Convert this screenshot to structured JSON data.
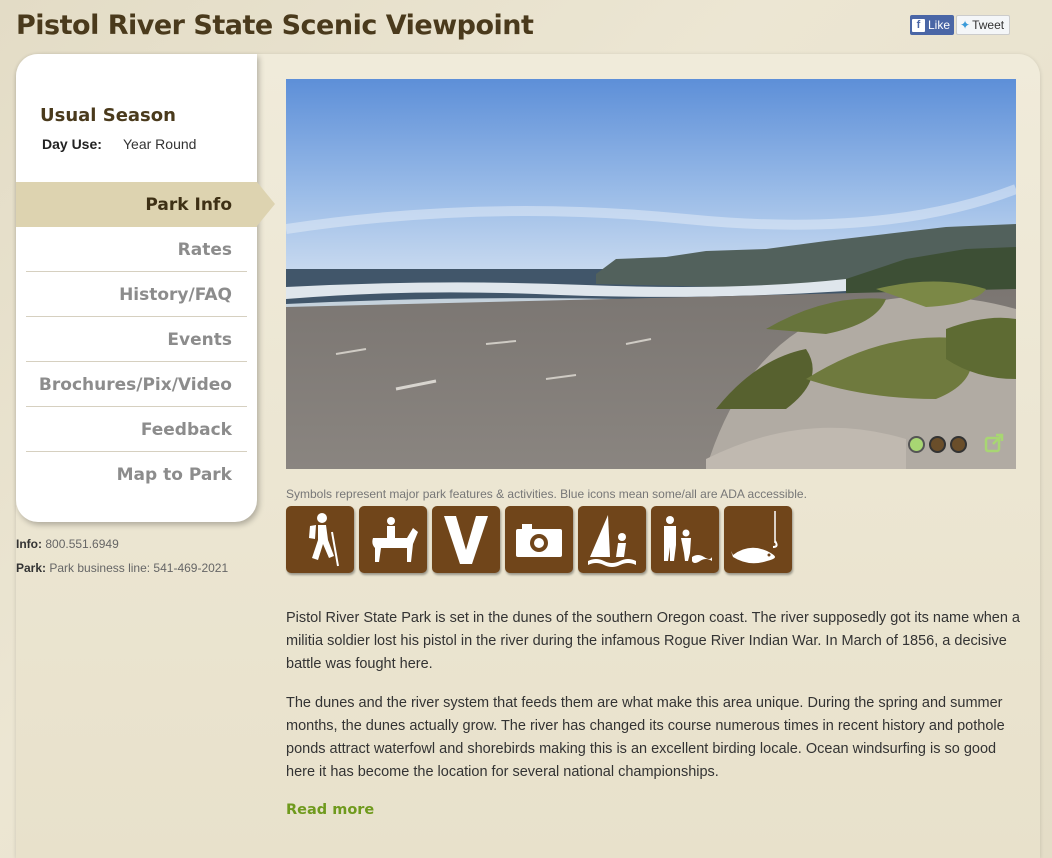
{
  "page": {
    "title": "Pistol River State Scenic Viewpoint"
  },
  "social": {
    "like_label": "Like",
    "tweet_label": "Tweet"
  },
  "sidebar": {
    "season_title": "Usual Season",
    "day_use_label": "Day Use:",
    "day_use_value": "Year Round",
    "nav": [
      {
        "label": "Park Info",
        "active": true
      },
      {
        "label": "Rates",
        "active": false
      },
      {
        "label": "History/FAQ",
        "active": false
      },
      {
        "label": "Events",
        "active": false
      },
      {
        "label": "Brochures/Pix/Video",
        "active": false
      },
      {
        "label": "Feedback",
        "active": false
      },
      {
        "label": "Map to Park",
        "active": false
      }
    ]
  },
  "contact": {
    "info_label": "Info:",
    "info_value": "800.551.6949",
    "park_label": "Park:",
    "park_value": "Park business line: 541-469-2021"
  },
  "slideshow": {
    "current_slide": 1,
    "total_slides": 3
  },
  "symbols_note": "Symbols represent major park features & activities. Blue icons mean some/all are ADA accessible.",
  "activity_icons": [
    "hiking-icon",
    "horseback-riding-icon",
    "viewpoint-icon",
    "photography-icon",
    "windsurfing-icon",
    "beach-access-icon",
    "fishing-icon"
  ],
  "description": {
    "paragraph1": "Pistol River State Park is set in the dunes of the southern Oregon coast.  The river supposedly got its name when a militia soldier lost his pistol in the river during the infamous Rogue River Indian War.  In March of 1856, a decisive battle was fought here.",
    "paragraph2": "The dunes and the river system that feeds them are what make this area unique.  During the spring and summer months, the dunes actually grow.  The river has changed its course numerous times in recent history and pothole ponds attract waterfowl and shorebirds making this is an excellent birding locale.  Ocean windsurfing is so good here it has become the location for several national championships.",
    "read_more": "Read more"
  },
  "colors": {
    "title_brown": "#4a3a1c",
    "icon_brown": "#70451a",
    "active_nav": "#ddd3b0",
    "link_green": "#6f9a1d"
  }
}
